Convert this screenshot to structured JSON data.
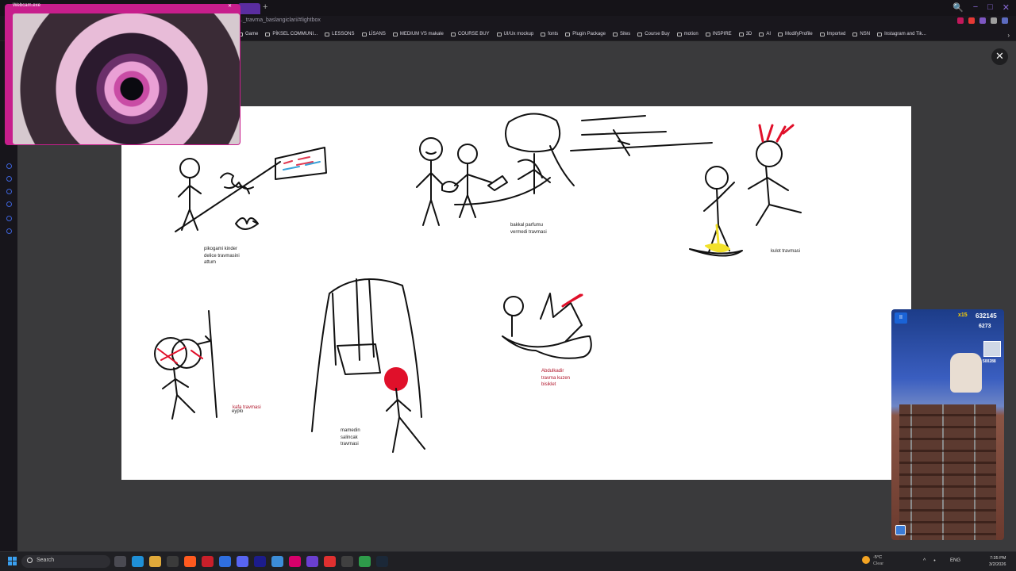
{
  "browser": {
    "url": "..._travma_baslangiclari/#lightbox",
    "new_tab_symbol": "+",
    "window_controls": [
      "🔍",
      "−",
      "□",
      "✕"
    ],
    "bookmarks_more": "›",
    "bookmarks": [
      "Game",
      "PİKSEL COMMUNI...",
      "LESSONS",
      "LİSANS",
      "MEDIUM VS makale",
      "COURSE BUY",
      "UI/Ux mockup",
      "fonts",
      "Plugin Package",
      "Sites",
      "Course Buy",
      "motion",
      "INSPIRE",
      "3D",
      "AI",
      "ModifyProfile",
      "Imported",
      "NSN",
      "Instagram and Tik..."
    ],
    "extension_colors": [
      "#c2185b",
      "#e53935",
      "#7e57c2",
      "#9e9e9e",
      "#5c6bc0"
    ]
  },
  "lightbox": {
    "close_symbol": "✕",
    "captions": [
      "pikogami kinder\ndelice travmasini\nattum",
      "bakkal parfumu\nvermedi travmasi",
      "kulot travmasi",
      "kafa travmasi",
      "eyplo",
      "mamedin\nsalincak\ntravmasi",
      "Abdulkadir\ntravma kuzen\nbisiklet"
    ]
  },
  "webcam": {
    "title": "Webcam.exe",
    "close_symbol": "✕"
  },
  "game": {
    "pause_symbol": "II",
    "multiplier": "x15",
    "score": "632145",
    "coins": "6273",
    "best": "500288"
  },
  "taskbar": {
    "search_placeholder": "Search",
    "app_colors": [
      "#4a4a52",
      "#1f8fd6",
      "#e0a93a",
      "#3b3b3b",
      "#ff5a1f",
      "#c91f2a",
      "#2f6fe0",
      "#5865f2",
      "#1c1c8c",
      "#3c8dd8",
      "#d7006b",
      "#6a3fd0",
      "#e03030",
      "#404040",
      "#2e9b4a",
      "#1b2838"
    ],
    "weather_temp": "-5°C",
    "weather_cond": "Clear",
    "lang": "ENG",
    "time": "7:35 PM",
    "date": "3/2/2026"
  }
}
